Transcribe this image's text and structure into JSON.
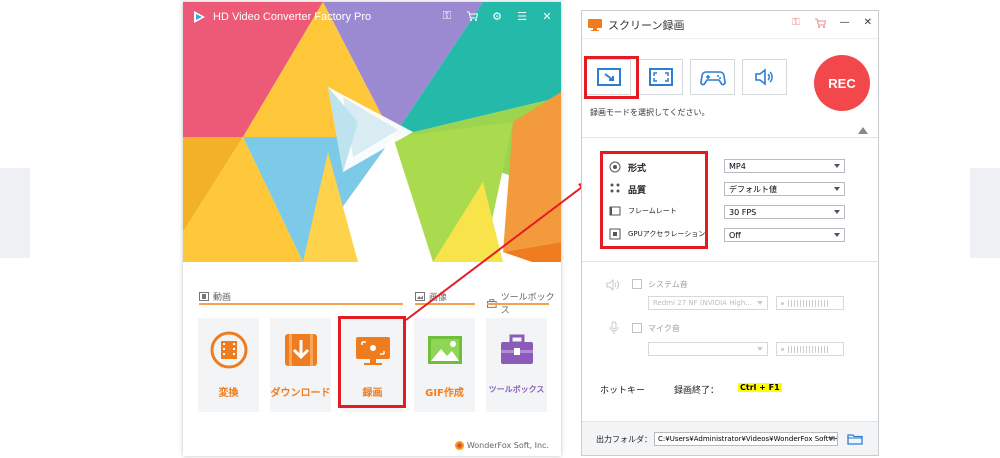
{
  "main": {
    "title": "HD Video Converter Factory Pro",
    "sections": {
      "video": "動画",
      "image": "画像",
      "toolbox": "ツールボックス"
    },
    "tiles": [
      {
        "label": "変換",
        "color": "#ef7d1f"
      },
      {
        "label": "ダウンロード",
        "color": "#ef7d1f"
      },
      {
        "label": "録画",
        "color": "#ef7d1f"
      },
      {
        "label": "GIF作成",
        "color": "#ef7d1f"
      },
      {
        "label": "ツールボックス",
        "color": "#8a5bb8"
      }
    ],
    "brand": "WonderFox Soft, Inc."
  },
  "rec": {
    "title": "スクリーン録画",
    "rec_label": "REC",
    "hint": "録画モードを選択してください。",
    "settings": [
      {
        "label": "形式",
        "value": "MP4"
      },
      {
        "label": "品質",
        "value": "デフォルト値"
      },
      {
        "label": "フレームレート",
        "value": "30 FPS"
      },
      {
        "label": "GPUアクセラレーション",
        "value": "Off"
      }
    ],
    "audio": {
      "system_label": "システム音",
      "system_device": "Redmi 27 NF (NVIDIA High...",
      "mic_label": "マイク音",
      "mic_device": ""
    },
    "hotkey_label": "ホットキー",
    "hotkey_action": "録画終了：",
    "hotkey_value": "Ctrl + F1",
    "output_label": "出力フォルダ：",
    "output_path": "C:¥Users¥Administrator¥Videos¥WonderFox Soft¥HD V"
  },
  "colors": {
    "accent_orange": "#ef7d1f",
    "highlight_red": "#e51b24",
    "rec_red": "#f2484b",
    "title_blue": "#2d7dd2"
  }
}
